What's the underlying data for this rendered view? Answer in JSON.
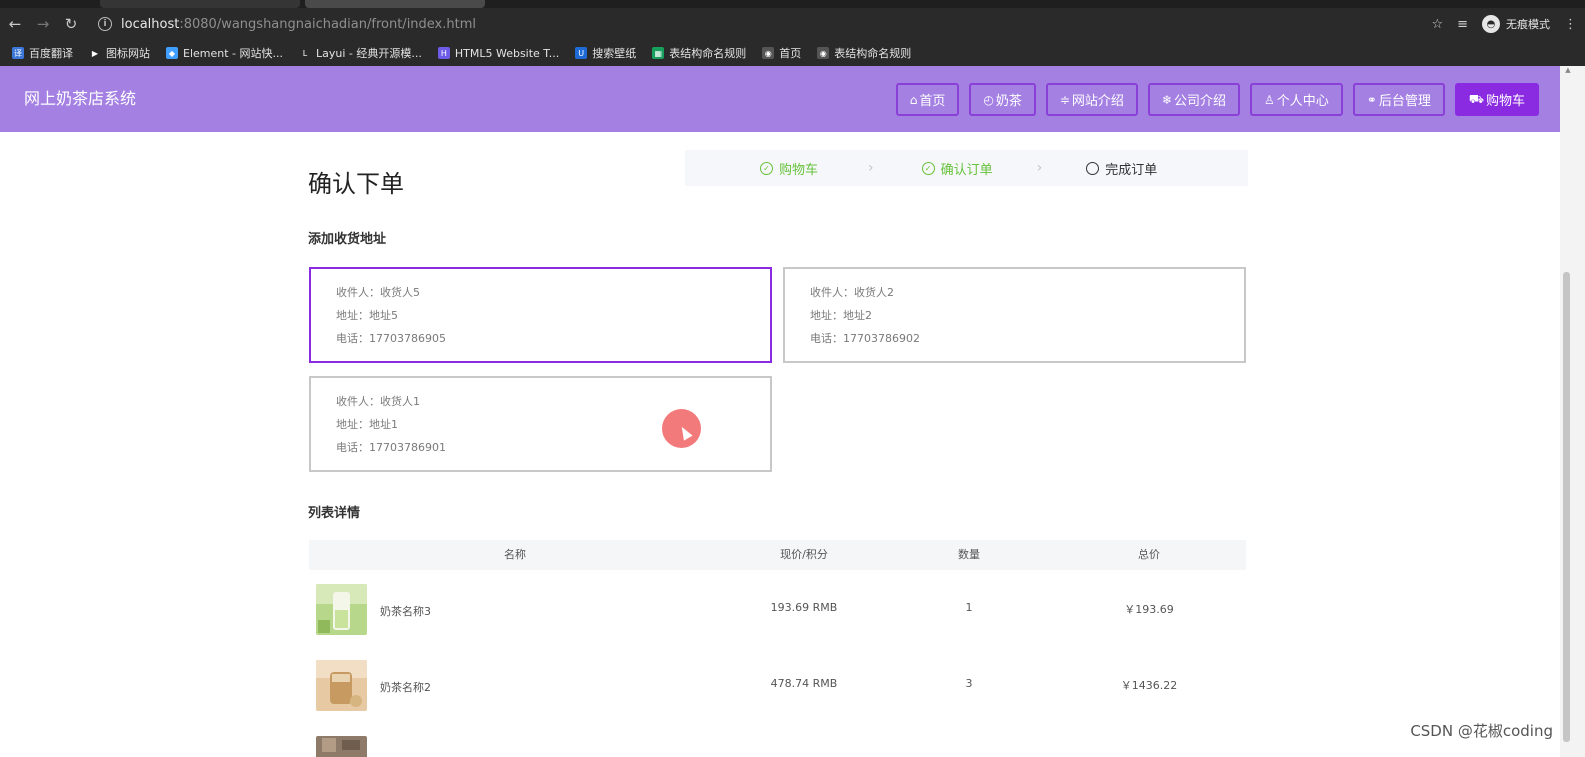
{
  "browser": {
    "url_host": "localhost",
    "url_rest": ":8080/wangshangnaichadian/front/index.html",
    "incognito_label": "无痕模式",
    "bookmarks": [
      {
        "label": "百度翻译",
        "color": "#3a77d8",
        "glyph": "译"
      },
      {
        "label": "图标网站",
        "color": "#2a2a2a",
        "glyph": "▶"
      },
      {
        "label": "Element - 网站快...",
        "color": "#409eff",
        "glyph": "◆"
      },
      {
        "label": "Layui - 经典开源模...",
        "color": "#2a2a2a",
        "glyph": "L"
      },
      {
        "label": "HTML5 Website T...",
        "color": "#6c5ce7",
        "glyph": "H"
      },
      {
        "label": "搜索壁纸",
        "color": "#1e6bd8",
        "glyph": "U"
      },
      {
        "label": "表结构命名规则",
        "color": "#17a05d",
        "glyph": "▦"
      },
      {
        "label": "首页",
        "color": "#555555",
        "glyph": "◉"
      },
      {
        "label": "表结构命名规则",
        "color": "#555555",
        "glyph": "◉"
      }
    ]
  },
  "header": {
    "brand": "网上奶茶店系统",
    "nav": [
      {
        "icon": "⌂",
        "label": "首页",
        "name": "nav-home-button",
        "icon_name": "home-icon"
      },
      {
        "icon": "◴",
        "label": "奶茶",
        "name": "nav-milktea-button",
        "icon_name": "clock-icon"
      },
      {
        "icon": "≑",
        "label": "网站介绍",
        "name": "nav-site-intro-button",
        "icon_name": "list-icon"
      },
      {
        "icon": "❄",
        "label": "公司介绍",
        "name": "nav-company-intro-button",
        "icon_name": "snowflake-icon"
      },
      {
        "icon": "♙",
        "label": "个人中心",
        "name": "nav-user-center-button",
        "icon_name": "user-icon"
      },
      {
        "icon": "⚭",
        "label": "后台管理",
        "name": "nav-admin-button",
        "icon_name": "link-icon"
      },
      {
        "icon": "⛟",
        "label": "购物车",
        "name": "nav-cart-button",
        "icon_name": "cart-icon",
        "active": true
      }
    ]
  },
  "page": {
    "title": "确认下单",
    "steps": [
      {
        "label": "购物车",
        "status": "done"
      },
      {
        "label": "确认订单",
        "status": "done"
      },
      {
        "label": "完成订单",
        "status": "current"
      }
    ],
    "address_section_title": "添加收货地址",
    "addresses": [
      {
        "recipient": "收件人：收货人5",
        "address": "地址：地址5",
        "phone": "电话：17703786905",
        "selected": true
      },
      {
        "recipient": "收件人：收货人2",
        "address": "地址：地址2",
        "phone": "电话：17703786902",
        "selected": false
      },
      {
        "recipient": "收件人：收货人1",
        "address": "地址：地址1",
        "phone": "电话：17703786901",
        "selected": false
      }
    ],
    "list_section_title": "列表详情",
    "table": {
      "headers": [
        "名称",
        "现价/积分",
        "数量",
        "总价"
      ],
      "rows": [
        {
          "name": "奶茶名称3",
          "price": "193.69 RMB",
          "qty": "1",
          "total": "￥193.69"
        },
        {
          "name": "奶茶名称2",
          "price": "478.74 RMB",
          "qty": "3",
          "total": "￥1436.22"
        }
      ]
    }
  },
  "watermark": "CSDN @花椒coding",
  "colors": {
    "header_bg": "#a480e3",
    "accent": "#8a2be2",
    "step_done": "#67c23a"
  }
}
